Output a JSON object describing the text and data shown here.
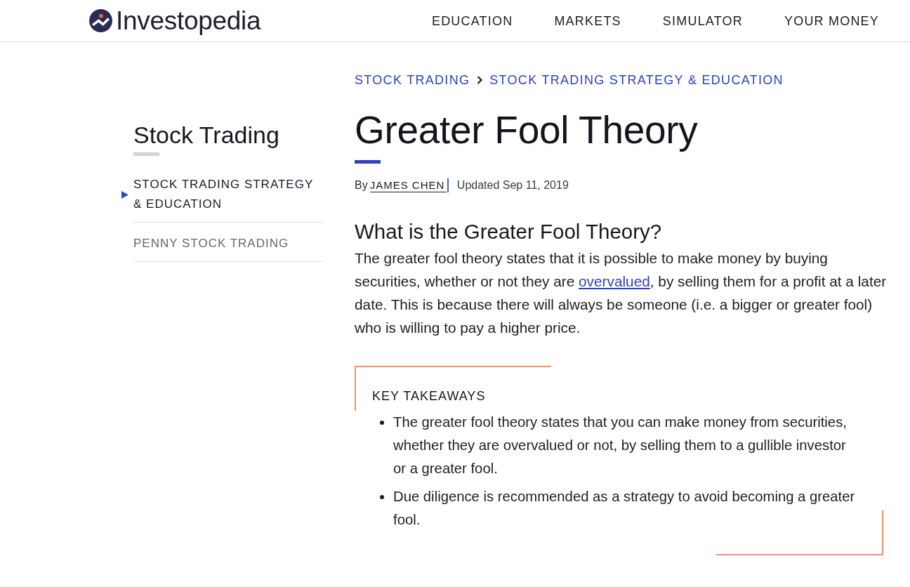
{
  "header": {
    "logo": "Investopedia",
    "nav": [
      "EDUCATION",
      "MARKETS",
      "SIMULATOR",
      "YOUR MONEY"
    ]
  },
  "sidebar": {
    "title": "Stock Trading",
    "items": [
      {
        "label": "STOCK TRADING STRATEGY & EDUCATION",
        "selected": true
      },
      {
        "label": "PENNY STOCK TRADING",
        "selected": false
      }
    ]
  },
  "breadcrumb": [
    "STOCK TRADING",
    "STOCK TRADING STRATEGY & EDUCATION"
  ],
  "article": {
    "title": "Greater Fool Theory",
    "byline": {
      "prefix": "By",
      "author": "JAMES CHEN",
      "updated": "Updated Sep 11, 2019"
    },
    "section_heading": "What is the Greater Fool Theory?",
    "paragraph": {
      "before": "The greater fool theory states that it is possible to make money by buying securities, whether or not they are ",
      "link": "overvalued",
      "after": ", by selling them for a profit at a later date. This is because there will always be someone (i.e. a bigger or greater fool) who is willing to pay a higher price."
    },
    "key_takeaways": {
      "title": "KEY TAKEAWAYS",
      "items": [
        "The greater fool theory states that you can make money from securities, whether they are overvalued or not, by selling them to a gullible investor or a greater fool.",
        "Due diligence is recommended as a strategy to avoid becoming a greater fool."
      ]
    }
  }
}
